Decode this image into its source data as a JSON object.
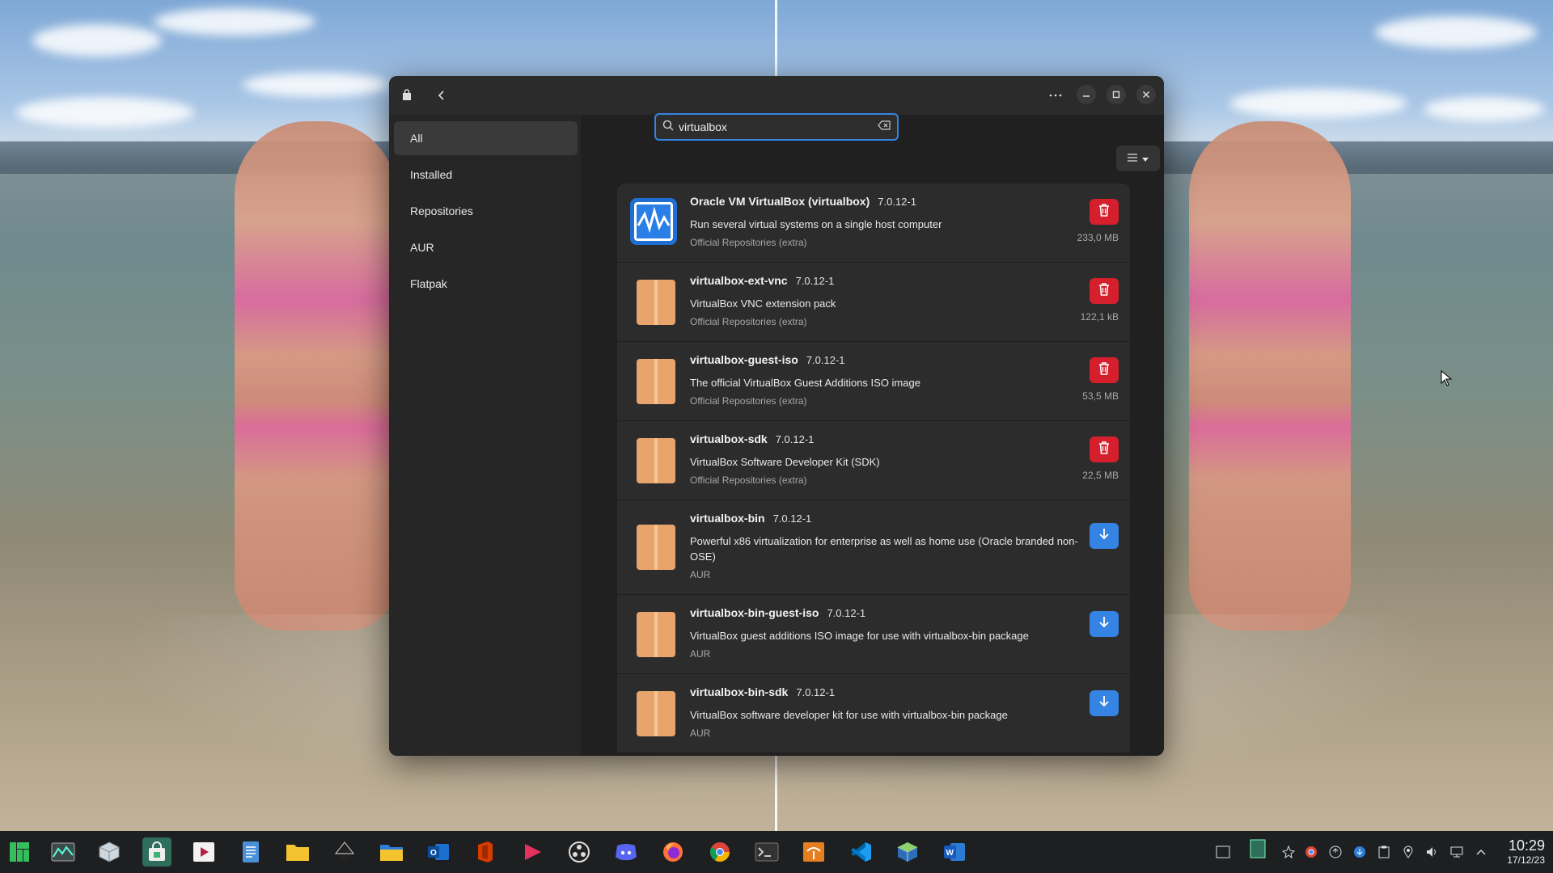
{
  "window": {
    "search_value": "virtualbox",
    "icons": {
      "app": "bag-icon",
      "back": "back-arrow-icon",
      "menu": "more-icon",
      "minimize": "minimize-icon",
      "maximize": "maximize-icon",
      "close": "close-icon"
    }
  },
  "sidebar": {
    "items": [
      {
        "label": "All",
        "active": true
      },
      {
        "label": "Installed"
      },
      {
        "label": "Repositories"
      },
      {
        "label": "AUR"
      },
      {
        "label": "Flatpak"
      }
    ]
  },
  "packages": [
    {
      "name": "Oracle VM VirtualBox (virtualbox)",
      "version": "7.0.12-1",
      "description": "Run several virtual systems on a single host computer",
      "repo": "Official Repositories (extra)",
      "size": "233,0 MB",
      "action": "remove"
    },
    {
      "name": "virtualbox-ext-vnc",
      "version": "7.0.12-1",
      "description": "VirtualBox VNC extension pack",
      "repo": "Official Repositories (extra)",
      "size": "122,1 kB",
      "action": "remove"
    },
    {
      "name": "virtualbox-guest-iso",
      "version": "7.0.12-1",
      "description": "The official VirtualBox Guest Additions ISO image",
      "repo": "Official Repositories (extra)",
      "size": "53,5 MB",
      "action": "remove"
    },
    {
      "name": "virtualbox-sdk",
      "version": "7.0.12-1",
      "description": "VirtualBox Software Developer Kit (SDK)",
      "repo": "Official Repositories (extra)",
      "size": "22,5 MB",
      "action": "remove"
    },
    {
      "name": "virtualbox-bin",
      "version": "7.0.12-1",
      "description": "Powerful x86 virtualization for enterprise as well as home use (Oracle branded non-OSE)",
      "repo": "AUR",
      "action": "install"
    },
    {
      "name": "virtualbox-bin-guest-iso",
      "version": "7.0.12-1",
      "description": "VirtualBox guest additions ISO image for use with virtualbox-bin package",
      "repo": "AUR",
      "action": "install"
    },
    {
      "name": "virtualbox-bin-sdk",
      "version": "7.0.12-1",
      "description": "VirtualBox software developer kit for use with virtualbox-bin package",
      "repo": "AUR",
      "action": "install"
    }
  ],
  "taskbar": {
    "apps": [
      "manjaro-menu-icon",
      "system-monitor-icon",
      "package-icon",
      "software-store-icon",
      "video-player-icon",
      "text-editor-icon",
      "file-manager-icon",
      "inkscape-icon",
      "files-icon",
      "outlook-icon",
      "office-icon",
      "media-player-icon",
      "obs-icon",
      "discord-icon",
      "firefox-icon",
      "chrome-icon",
      "terminal-icon",
      "archive-icon",
      "vscode-icon",
      "virtualbox-icon",
      "word-icon"
    ],
    "time": "10:29",
    "date": "17/12/23"
  },
  "colors": {
    "accent": "#3584e4",
    "danger": "#d51f2d",
    "pkg_orange": "#e9a46c"
  }
}
